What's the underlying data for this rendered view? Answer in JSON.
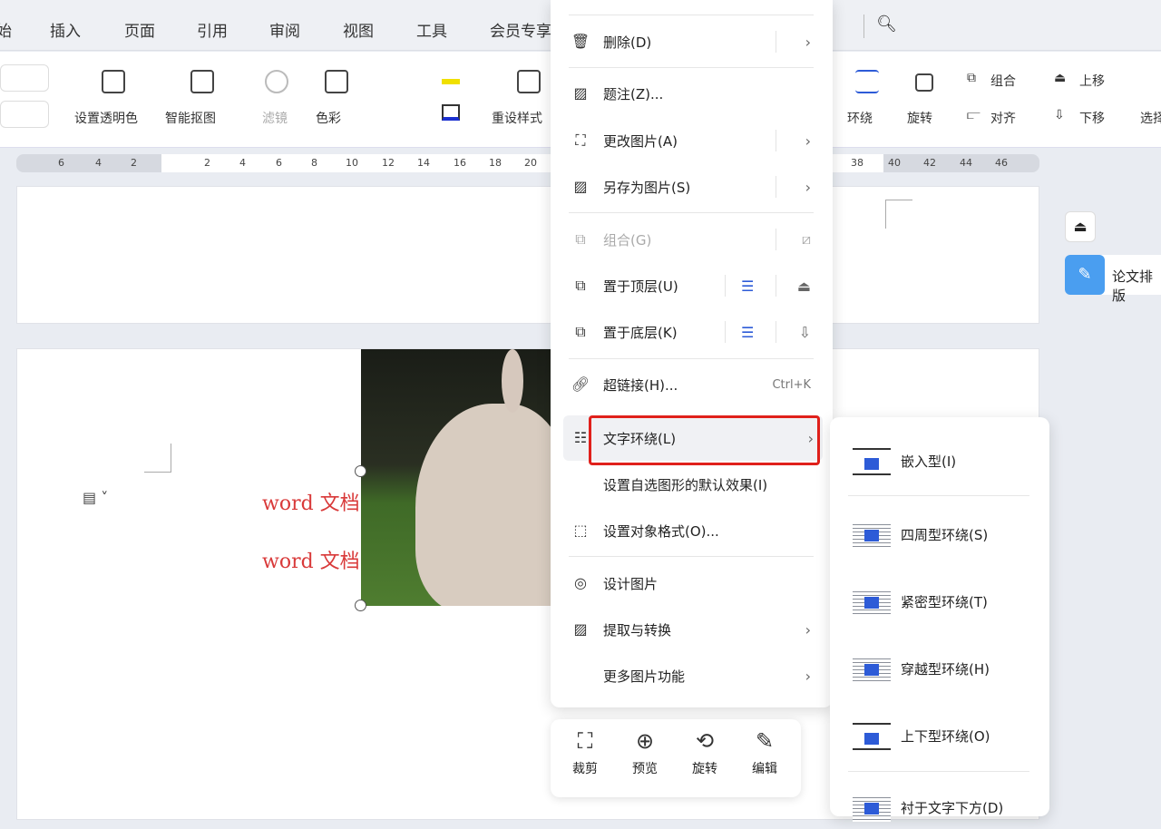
{
  "tabs": [
    "始",
    "插入",
    "页面",
    "引用",
    "审阅",
    "视图",
    "工具",
    "会员专享"
  ],
  "ribbon": {
    "set_transparent": "设置透明色",
    "smart_cutout": "智能抠图",
    "filter": "滤镜",
    "color": "色彩",
    "reset_style": "重设样式",
    "wrap": "环绕",
    "rotate": "旋转",
    "group": "组合",
    "align": "对齐",
    "move_up": "上移",
    "move_down": "下移",
    "select": "选择"
  },
  "ruler": {
    "ticks": [
      "6",
      "4",
      "2",
      "2",
      "4",
      "6",
      "8",
      "10",
      "12",
      "14",
      "16",
      "18",
      "20",
      "38",
      "40",
      "42",
      "44",
      "46"
    ]
  },
  "document": {
    "line1": "word 文档",
    "line2": "word 文档"
  },
  "side_panel": {
    "paper_layout": "论文排版"
  },
  "context_menu": {
    "items": [
      {
        "label": "删除(D)",
        "icon": "trash-icon",
        "submenu": true
      },
      {
        "label": "题注(Z)...",
        "icon": "image-caption-icon"
      },
      {
        "label": "更改图片(A)",
        "icon": "change-image-icon",
        "submenu": true
      },
      {
        "label": "另存为图片(S)",
        "icon": "save-image-icon",
        "submenu": true
      },
      {
        "label": "组合(G)",
        "icon": "group-icon",
        "disabled": true
      },
      {
        "label": "置于顶层(U)",
        "icon": "bring-front-icon"
      },
      {
        "label": "置于底层(K)",
        "icon": "send-back-icon"
      },
      {
        "label": "超链接(H)...",
        "icon": "link-icon",
        "shortcut": "Ctrl+K"
      },
      {
        "label": "文字环绕(L)",
        "icon": "text-wrap-icon",
        "submenu": true,
        "highlighted": true
      },
      {
        "label": "设置自选图形的默认效果(I)",
        "icon": ""
      },
      {
        "label": "设置对象格式(O)...",
        "icon": "format-object-icon"
      },
      {
        "label": "设计图片",
        "icon": "design-image-icon"
      },
      {
        "label": "提取与转换",
        "icon": "extract-icon",
        "submenu": true
      },
      {
        "label": "更多图片功能",
        "icon": "",
        "submenu": true
      }
    ]
  },
  "wrap_submenu": {
    "items": [
      "嵌入型(I)",
      "四周型环绕(S)",
      "紧密型环绕(T)",
      "穿越型环绕(H)",
      "上下型环绕(O)",
      "衬于文字下方(D)"
    ]
  },
  "image_toolbar": {
    "items": [
      "裁剪",
      "预览",
      "旋转",
      "编辑"
    ]
  },
  "colors": {
    "highlight": "#e0201b",
    "accent": "#2d5bd7",
    "doc_text": "#d93a3a"
  }
}
